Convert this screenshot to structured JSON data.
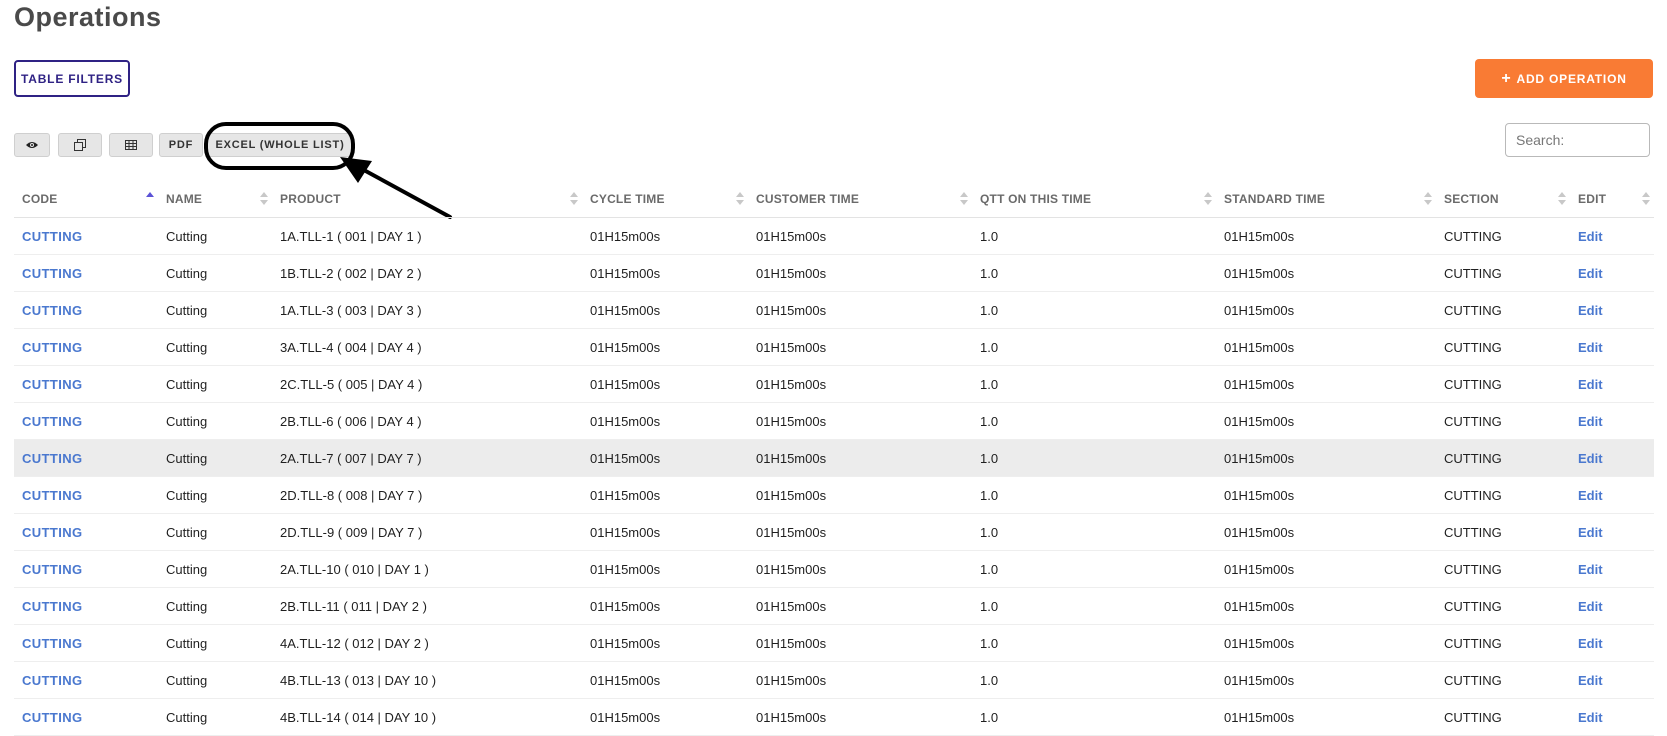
{
  "page": {
    "title": "Operations"
  },
  "actions": {
    "table_filters_label": "TABLE FILTERS",
    "add_operation_label": "ADD OPERATION",
    "add_icon": "plus-icon"
  },
  "toolbar": {
    "buttons": [
      {
        "label": "",
        "icon": "eye-icon"
      },
      {
        "label": "",
        "icon": "copy-icon"
      },
      {
        "label": "",
        "icon": "table-icon"
      },
      {
        "label": "PDF",
        "icon": ""
      },
      {
        "label": "EXCEL (WHOLE LIST)",
        "icon": ""
      }
    ],
    "highlighted_button": "EXCEL (WHOLE LIST)"
  },
  "search": {
    "label": "Search:",
    "value": ""
  },
  "table": {
    "sorted_column": "CODE",
    "sort_direction": "ascending",
    "columns": [
      "CODE",
      "NAME",
      "PRODUCT",
      "CYCLE TIME",
      "CUSTOMER TIME",
      "QTT ON THIS TIME",
      "STANDARD TIME",
      "SECTION",
      "EDIT"
    ],
    "rows": [
      {
        "code": "CUTTING",
        "name": "Cutting",
        "product": "1A.TLL-1 ( 001 | DAY 1 )",
        "cycle_time": "01H15m00s",
        "customer_time": "01H15m00s",
        "qtt": "1.0",
        "standard_time": "01H15m00s",
        "section": "CUTTING",
        "edit": "Edit"
      },
      {
        "code": "CUTTING",
        "name": "Cutting",
        "product": "1B.TLL-2 ( 002 | DAY 2 )",
        "cycle_time": "01H15m00s",
        "customer_time": "01H15m00s",
        "qtt": "1.0",
        "standard_time": "01H15m00s",
        "section": "CUTTING",
        "edit": "Edit"
      },
      {
        "code": "CUTTING",
        "name": "Cutting",
        "product": "1A.TLL-3 ( 003 | DAY 3 )",
        "cycle_time": "01H15m00s",
        "customer_time": "01H15m00s",
        "qtt": "1.0",
        "standard_time": "01H15m00s",
        "section": "CUTTING",
        "edit": "Edit"
      },
      {
        "code": "CUTTING",
        "name": "Cutting",
        "product": "3A.TLL-4 ( 004 | DAY 4 )",
        "cycle_time": "01H15m00s",
        "customer_time": "01H15m00s",
        "qtt": "1.0",
        "standard_time": "01H15m00s",
        "section": "CUTTING",
        "edit": "Edit"
      },
      {
        "code": "CUTTING",
        "name": "Cutting",
        "product": "2C.TLL-5 ( 005 | DAY 4 )",
        "cycle_time": "01H15m00s",
        "customer_time": "01H15m00s",
        "qtt": "1.0",
        "standard_time": "01H15m00s",
        "section": "CUTTING",
        "edit": "Edit"
      },
      {
        "code": "CUTTING",
        "name": "Cutting",
        "product": "2B.TLL-6 ( 006 | DAY 4 )",
        "cycle_time": "01H15m00s",
        "customer_time": "01H15m00s",
        "qtt": "1.0",
        "standard_time": "01H15m00s",
        "section": "CUTTING",
        "edit": "Edit"
      },
      {
        "code": "CUTTING",
        "name": "Cutting",
        "product": "2A.TLL-7 ( 007 | DAY 7 )",
        "cycle_time": "01H15m00s",
        "customer_time": "01H15m00s",
        "qtt": "1.0",
        "standard_time": "01H15m00s",
        "section": "CUTTING",
        "edit": "Edit",
        "highlighted": true
      },
      {
        "code": "CUTTING",
        "name": "Cutting",
        "product": "2D.TLL-8 ( 008 | DAY 7 )",
        "cycle_time": "01H15m00s",
        "customer_time": "01H15m00s",
        "qtt": "1.0",
        "standard_time": "01H15m00s",
        "section": "CUTTING",
        "edit": "Edit"
      },
      {
        "code": "CUTTING",
        "name": "Cutting",
        "product": "2D.TLL-9 ( 009 | DAY 7 )",
        "cycle_time": "01H15m00s",
        "customer_time": "01H15m00s",
        "qtt": "1.0",
        "standard_time": "01H15m00s",
        "section": "CUTTING",
        "edit": "Edit"
      },
      {
        "code": "CUTTING",
        "name": "Cutting",
        "product": "2A.TLL-10 ( 010 | DAY 1 )",
        "cycle_time": "01H15m00s",
        "customer_time": "01H15m00s",
        "qtt": "1.0",
        "standard_time": "01H15m00s",
        "section": "CUTTING",
        "edit": "Edit"
      },
      {
        "code": "CUTTING",
        "name": "Cutting",
        "product": "2B.TLL-11 ( 011 | DAY 2 )",
        "cycle_time": "01H15m00s",
        "customer_time": "01H15m00s",
        "qtt": "1.0",
        "standard_time": "01H15m00s",
        "section": "CUTTING",
        "edit": "Edit"
      },
      {
        "code": "CUTTING",
        "name": "Cutting",
        "product": "4A.TLL-12 ( 012 | DAY 2 )",
        "cycle_time": "01H15m00s",
        "customer_time": "01H15m00s",
        "qtt": "1.0",
        "standard_time": "01H15m00s",
        "section": "CUTTING",
        "edit": "Edit"
      },
      {
        "code": "CUTTING",
        "name": "Cutting",
        "product": "4B.TLL-13 ( 013 | DAY 10 )",
        "cycle_time": "01H15m00s",
        "customer_time": "01H15m00s",
        "qtt": "1.0",
        "standard_time": "01H15m00s",
        "section": "CUTTING",
        "edit": "Edit"
      },
      {
        "code": "CUTTING",
        "name": "Cutting",
        "product": "4B.TLL-14 ( 014 | DAY 10 )",
        "cycle_time": "01H15m00s",
        "customer_time": "01H15m00s",
        "qtt": "1.0",
        "standard_time": "01H15m00s",
        "section": "CUTTING",
        "edit": "Edit"
      }
    ]
  },
  "colors": {
    "accent_orange": "#f97b34",
    "filter_border": "#2f2284",
    "link_blue": "#4a78cf",
    "sort_active": "#5b52d6",
    "row_highlight": "#ececec"
  }
}
